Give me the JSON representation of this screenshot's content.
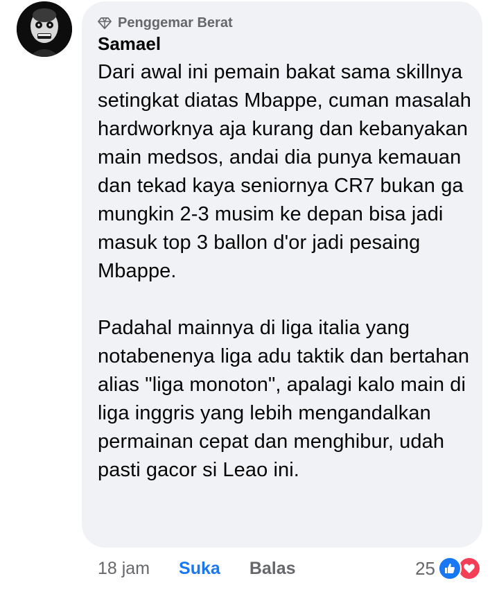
{
  "comment": {
    "badge": "Penggemar Berat",
    "author": "Samael",
    "text": "Dari awal ini pemain bakat sama skillnya setingkat diatas Mbappe, cuman masalah hardworknya aja kurang dan kebanyakan main medsos, andai dia punya kemauan dan tekad kaya seniornya CR7 bukan ga mungkin 2-3 musim ke depan bisa jadi masuk top 3 ballon d'or jadi pesaing Mbappe.\n\nPadahal mainnya di liga italia yang notabenenya liga adu taktik dan bertahan alias \"liga monoton\", apalagi kalo main di liga inggris yang lebih mengandalkan permainan cepat dan menghibur, udah pasti gacor si Leao ini.",
    "time": "18 jam",
    "like_label": "Suka",
    "reply_label": "Balas",
    "reaction_count": "25",
    "reaction_icons": [
      "like-icon",
      "love-icon"
    ]
  },
  "colors": {
    "bubble": "#f0f2f5",
    "accent": "#1877f2",
    "secondary_text": "#65676b",
    "love": "#f33e58"
  }
}
